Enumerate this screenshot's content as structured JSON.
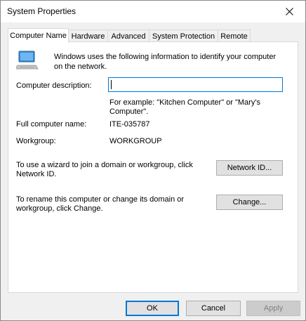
{
  "window": {
    "title": "System Properties"
  },
  "tabs": [
    {
      "label": "Computer Name",
      "active": true
    },
    {
      "label": "Hardware",
      "active": false
    },
    {
      "label": "Advanced",
      "active": false
    },
    {
      "label": "System Protection",
      "active": false
    },
    {
      "label": "Remote",
      "active": false
    }
  ],
  "computer_name": {
    "intro": "Windows uses the following information to identify your computer on the network.",
    "description_label": "Computer description:",
    "description_value": "",
    "example": "For example: \"Kitchen Computer\" or \"Mary's Computer\".",
    "full_name_label": "Full computer name:",
    "full_name_value": "ITE-035787",
    "workgroup_label": "Workgroup:",
    "workgroup_value": "WORKGROUP",
    "network_id_text": "To use a wizard to join a domain or workgroup, click Network ID.",
    "network_id_button": "Network ID...",
    "change_text": "To rename this computer or change its domain or workgroup, click Change.",
    "change_button": "Change..."
  },
  "footer": {
    "ok": "OK",
    "cancel": "Cancel",
    "apply": "Apply"
  },
  "colors": {
    "accent": "#0078d7",
    "panel": "#ffffff",
    "chrome": "#f0f0f0"
  },
  "icons": {
    "computer": "computer-monitor-icon",
    "close": "close-icon"
  }
}
